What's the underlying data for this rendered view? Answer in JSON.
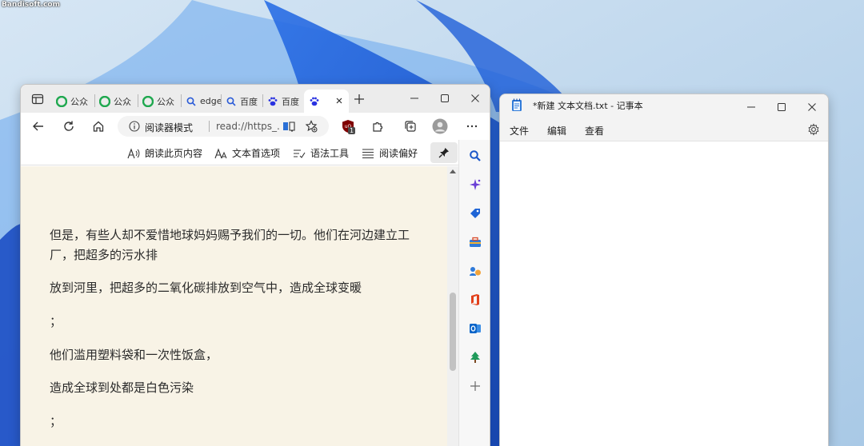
{
  "watermark": "Bandisoft.com",
  "edge": {
    "tabs": [
      {
        "title": "公众",
        "icon": "wechat-icon"
      },
      {
        "title": "公众",
        "icon": "wechat-icon"
      },
      {
        "title": "公众",
        "icon": "wechat-icon"
      },
      {
        "title": "edge",
        "icon": "search-icon"
      },
      {
        "title": "百度",
        "icon": "search-icon"
      },
      {
        "title": "百度",
        "icon": "baidu-paw-icon"
      },
      {
        "title": "",
        "icon": "baidu-paw-icon",
        "active": true
      }
    ],
    "address": {
      "reader_label": "阅读器模式",
      "url": "read://https_..."
    },
    "reader_toolbar": {
      "read_aloud": "朗读此页内容",
      "text_prefs": "文本首选项",
      "grammar_tools": "语法工具",
      "reading_prefs": "阅读偏好"
    },
    "article": {
      "paragraphs": [
        "但是，有些人却不爱惜地球妈妈赐予我们的一切。他们在河边建立工厂，把超多的污水排",
        "放到河里，把超多的二氧化碳排放到空气中，造成全球变暖",
        "；",
        "他们滥用塑料袋和一次性饭盒，",
        "造成全球到处都是白色污染",
        "；"
      ]
    },
    "extension_badge": "1",
    "scroll_position": 0.42
  },
  "notepad": {
    "title": "*新建 文本文档.txt - 记事本",
    "menu": [
      "文件",
      "编辑",
      "查看"
    ],
    "content": ""
  }
}
